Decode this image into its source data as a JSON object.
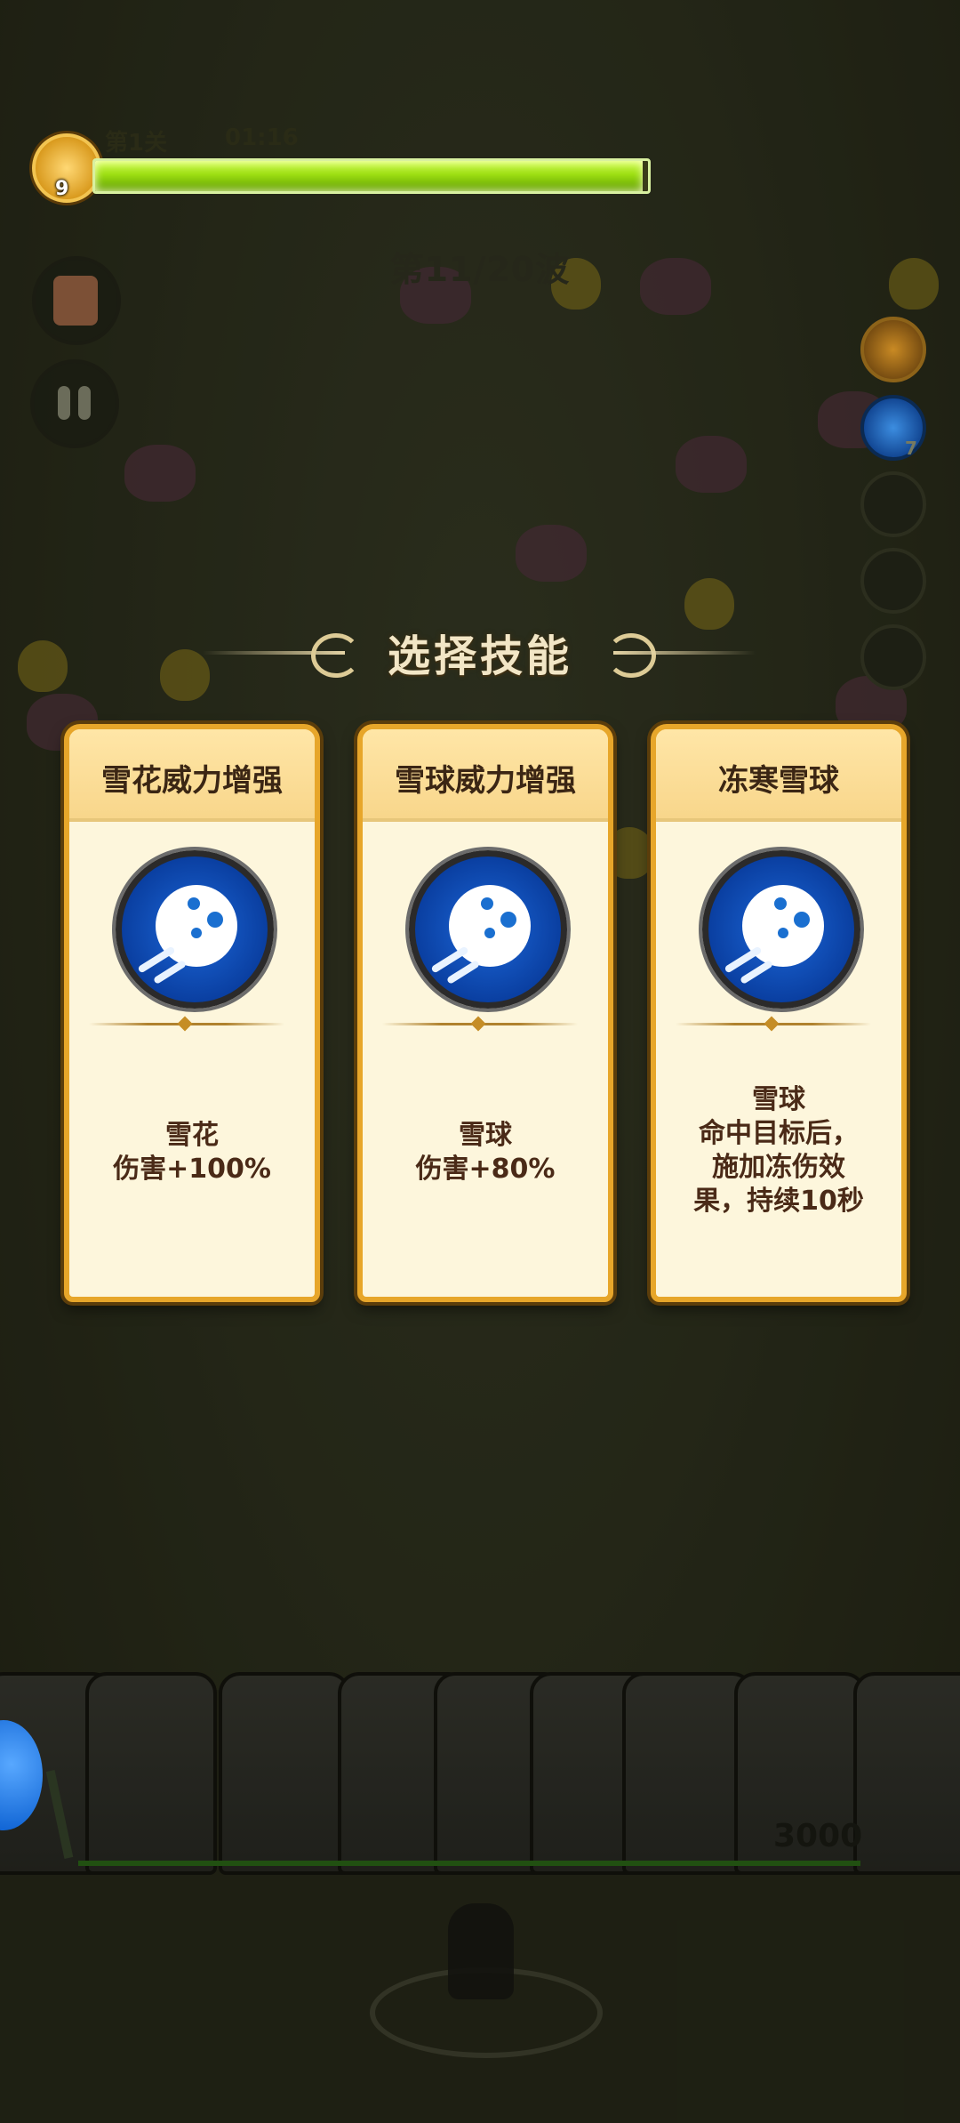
{
  "hud": {
    "level_number": "9",
    "stage_label": "第1关",
    "timer": "01:16",
    "progress": 0.99,
    "wave_label": "第11/20波"
  },
  "side_slots": {
    "count_label": "7"
  },
  "wall": {
    "hp_value": "3000"
  },
  "skill_select": {
    "title": "选择技能",
    "cards": [
      {
        "title": "雪花威力增强",
        "icon": "snowball-icon",
        "desc_lines": [
          "雪花",
          "伤害+100%"
        ]
      },
      {
        "title": "雪球威力增强",
        "icon": "snowball-icon",
        "desc_lines": [
          "雪球",
          "伤害+80%"
        ]
      },
      {
        "title": "冻寒雪球",
        "icon": "snowball-icon",
        "desc_lines": [
          "雪球",
          "命中目标后，",
          "施加冻伤效",
          "果，持续10秒"
        ]
      }
    ]
  },
  "colors": {
    "card_border": "#e7a62a",
    "card_bg": "#fdf6dc",
    "progress_fill": "#9cde12",
    "icon_blue": "#0a3fa1"
  }
}
